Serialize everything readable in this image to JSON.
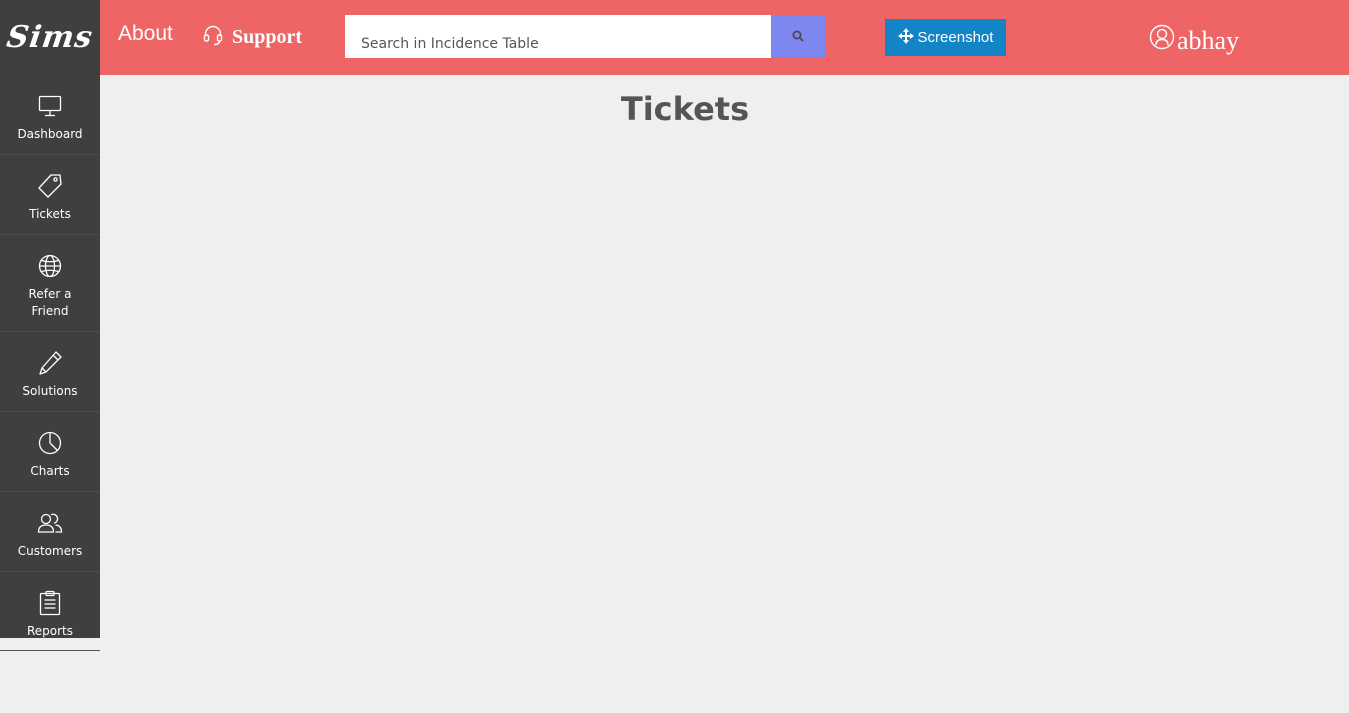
{
  "app": {
    "logo_text": "Sims"
  },
  "header": {
    "about_label": "About",
    "support_label": "Support",
    "search": {
      "placeholder": "Search in Incidence Table",
      "value": ""
    },
    "screenshot_label": "Screenshot",
    "user_name": "abhay",
    "background_color": "#ef6565"
  },
  "sidebar": {
    "items": [
      {
        "label": "Dashboard",
        "icon": "monitor-icon"
      },
      {
        "label": "Tickets",
        "icon": "tag-icon"
      },
      {
        "label": "Refer a Friend",
        "icon": "globe-icon"
      },
      {
        "label": "Solutions",
        "icon": "pencil-icon"
      },
      {
        "label": "Charts",
        "icon": "pie-chart-icon"
      },
      {
        "label": "Customers",
        "icon": "users-icon"
      },
      {
        "label": "Reports",
        "icon": "clipboard-icon"
      }
    ]
  },
  "main": {
    "title": "Tickets"
  }
}
